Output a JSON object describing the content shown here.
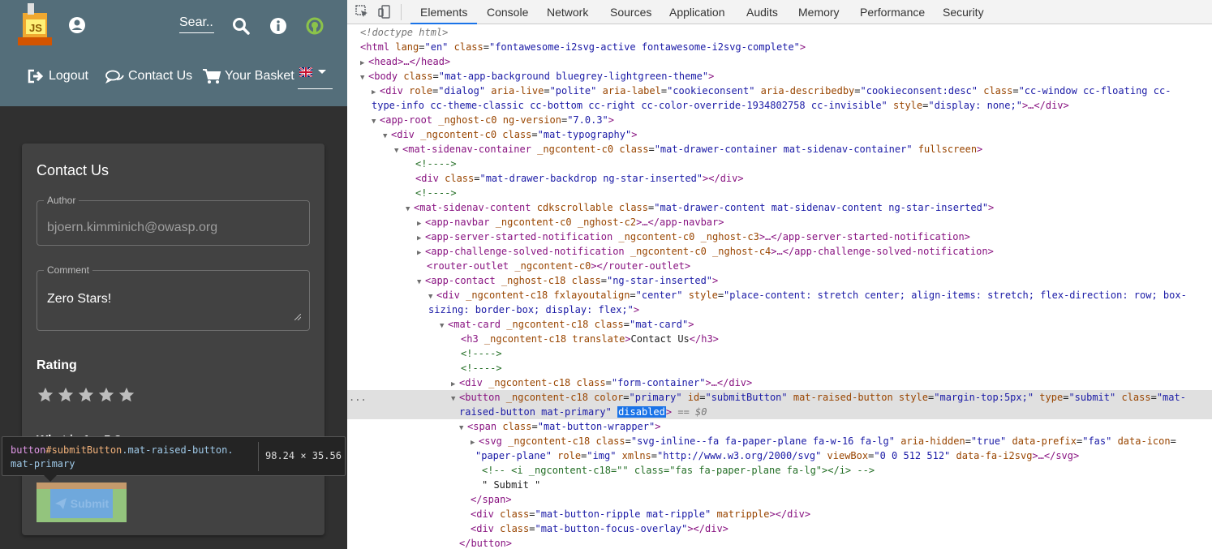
{
  "app": {
    "search_label": "Sear...",
    "nav": {
      "logout": "Logout",
      "contact": "Contact Us",
      "basket": "Your Basket"
    },
    "colors": {
      "toolbar": "#546e7a",
      "background": "#303030",
      "card": "#424242"
    }
  },
  "card": {
    "title": "Contact Us",
    "author_label": "Author",
    "author_value": "bjoern.kimminich@owasp.org",
    "comment_label": "Comment",
    "comment_value": "Zero Stars!",
    "rating_label": "Rating",
    "rating_value": 0,
    "rating_max": 5,
    "captcha_label": "What is 1 + 5 ?",
    "submit_label": "Submit"
  },
  "tooltip": {
    "tag": "button",
    "id": "#submitButton",
    "classes": ".mat-raised-button.",
    "classes2": "mat-primary",
    "size": "98.24 × 35.56"
  },
  "devtools": {
    "tabs": [
      "Elements",
      "Console",
      "Network",
      "Sources",
      "Application",
      "Audits",
      "Memory",
      "Performance",
      "Security"
    ],
    "active_tab": "Elements",
    "selected_marker": "...",
    "eq_label": "== $0"
  }
}
